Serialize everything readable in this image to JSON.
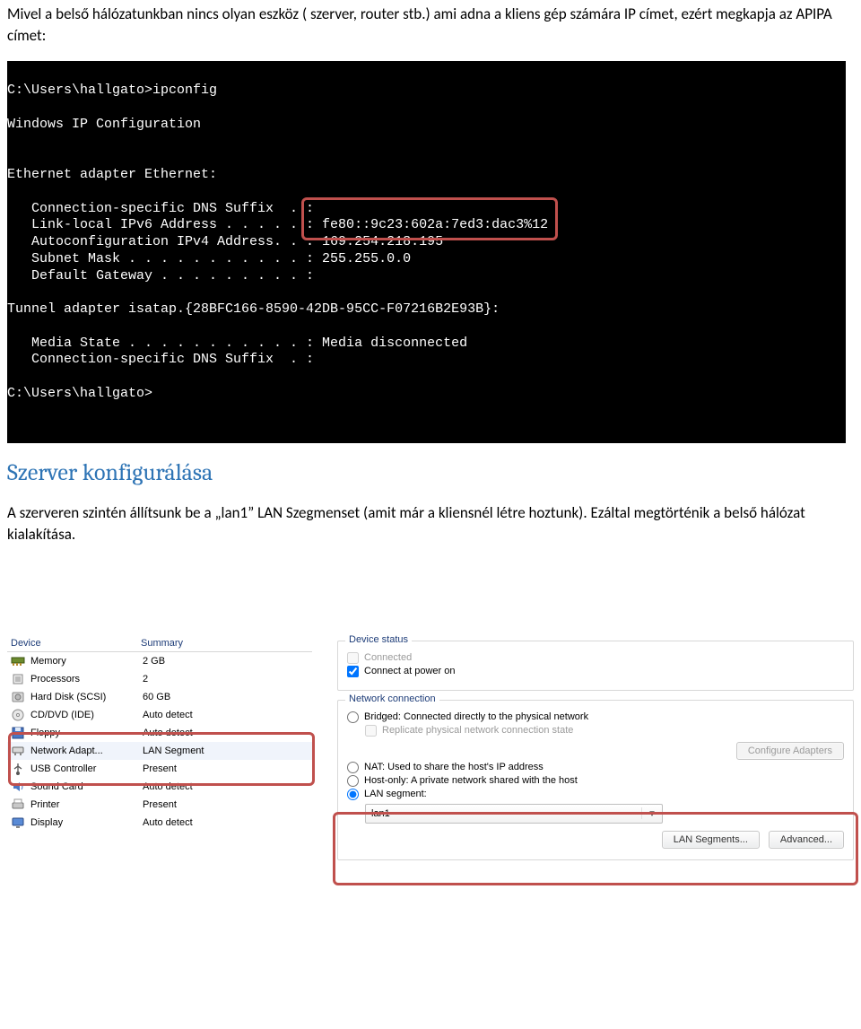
{
  "para1": "Mivel a belső hálózatunkban nincs olyan eszköz ( szerver, router stb.) ami adna a kliens gép számára IP címet, ezért megkapja az APIPA címet:",
  "terminal": {
    "l1": "C:\\Users\\hallgato>ipconfig",
    "l2": "",
    "l3": "Windows IP Configuration",
    "l4": "",
    "l5": "",
    "l6": "Ethernet adapter Ethernet:",
    "l7": "",
    "l8": "   Connection-specific DNS Suffix  . :",
    "l9": "   Link-local IPv6 Address . . . . . : fe80::9c23:602a:7ed3:dac3%12",
    "l10": "   Autoconfiguration IPv4 Address. . : 169.254.218.195",
    "l11": "   Subnet Mask . . . . . . . . . . . : 255.255.0.0",
    "l12": "   Default Gateway . . . . . . . . . :",
    "l13": "",
    "l14": "Tunnel adapter isatap.{28BFC166-8590-42DB-95CC-F07216B2E93B}:",
    "l15": "",
    "l16": "   Media State . . . . . . . . . . . : Media disconnected",
    "l17": "   Connection-specific DNS Suffix  . :",
    "l18": "",
    "l19": "C:\\Users\\hallgato>"
  },
  "heading": "Szerver konfigurálása",
  "para2": "A szerveren szintén állítsunk be a „lan1” LAN Szegmenset (amit már a kliensnél létre hoztunk). Ezáltal megtörténik a belső hálózat kialakítása.",
  "devices": {
    "colDevice": "Device",
    "colSummary": "Summary",
    "rows": [
      {
        "icon": "memory",
        "label": "Memory",
        "summary": "2 GB"
      },
      {
        "icon": "cpu",
        "label": "Processors",
        "summary": "2"
      },
      {
        "icon": "hdd",
        "label": "Hard Disk (SCSI)",
        "summary": "60 GB"
      },
      {
        "icon": "cd",
        "label": "CD/DVD (IDE)",
        "summary": "Auto detect"
      },
      {
        "icon": "floppy",
        "label": "Floppy",
        "summary": "Auto detect"
      },
      {
        "icon": "net",
        "label": "Network Adapt...",
        "summary": "LAN Segment"
      },
      {
        "icon": "usb",
        "label": "USB Controller",
        "summary": "Present"
      },
      {
        "icon": "snd",
        "label": "Sound Card",
        "summary": "Auto detect"
      },
      {
        "icon": "prn",
        "label": "Printer",
        "summary": "Present"
      },
      {
        "icon": "disp",
        "label": "Display",
        "summary": "Auto detect"
      }
    ]
  },
  "status": {
    "groupTitle": "Device status",
    "connected": "Connected",
    "connectPower": "Connect at power on"
  },
  "netconn": {
    "groupTitle": "Network connection",
    "bridged": "Bridged: Connected directly to the physical network",
    "replicate": "Replicate physical network connection state",
    "cfgAdapters": "Configure Adapters",
    "nat": "NAT: Used to share the host's IP address",
    "hostonly": "Host-only: A private network shared with the host",
    "lansegment": "LAN segment:",
    "lanValue": "lan1",
    "btnLanSeg": "LAN Segments...",
    "btnAdvanced": "Advanced..."
  }
}
